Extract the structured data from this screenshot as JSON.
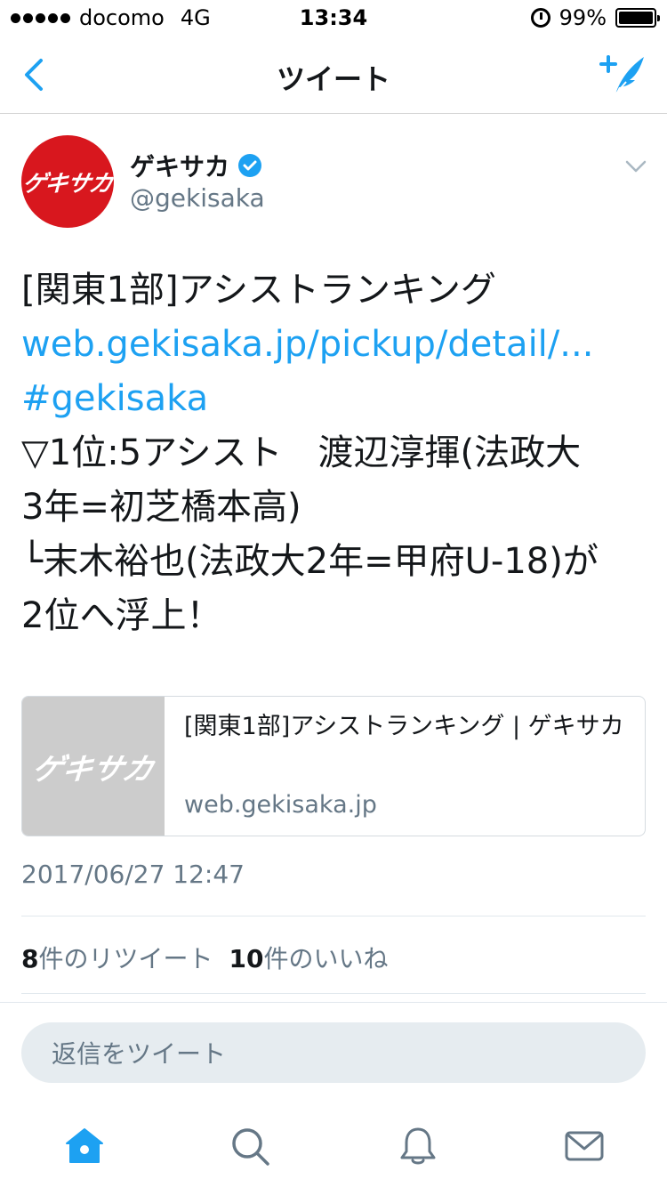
{
  "status_bar": {
    "carrier": "docomo",
    "network": "4G",
    "time": "13:34",
    "battery": "99%"
  },
  "nav": {
    "title": "ツイート",
    "back_icon": "chevron-left-icon",
    "compose_icon": "compose-tweet-icon"
  },
  "tweet": {
    "avatar_text": "ゲキサカ",
    "author_name": "ゲキサカ",
    "verified": true,
    "handle": "@gekisaka",
    "lines": [
      "[関東1部]アシストランキング",
      "web.gekisaka.jp/pickup/detail/...",
      "#gekisaka",
      "▽1位:5アシスト　渡辺淳揮(法政大",
      "3年=初芝橋本高)",
      "└末木裕也(法政大2年=甲府U-18)が",
      "2位へ浮上！"
    ],
    "timestamp": "2017/06/27 12:47",
    "retweet_count": "8",
    "retweet_label": "件のリツイート",
    "like_count": "10",
    "like_label": "件のいいね"
  },
  "card": {
    "thumb_text": "ゲキサカ",
    "title": "[関東1部]アシストランキング | ゲキサカ",
    "domain": "web.gekisaka.jp"
  },
  "reply": {
    "placeholder": "返信をツイート"
  },
  "tabs": [
    {
      "name": "home",
      "icon": "home-icon",
      "active": true
    },
    {
      "name": "search",
      "icon": "search-icon",
      "active": false
    },
    {
      "name": "notifications",
      "icon": "bell-icon",
      "active": false
    },
    {
      "name": "messages",
      "icon": "envelope-icon",
      "active": false
    }
  ],
  "colors": {
    "accent": "#1da1f2",
    "avatar_bg": "#d8171e",
    "muted": "#657786",
    "text": "#14171a"
  }
}
